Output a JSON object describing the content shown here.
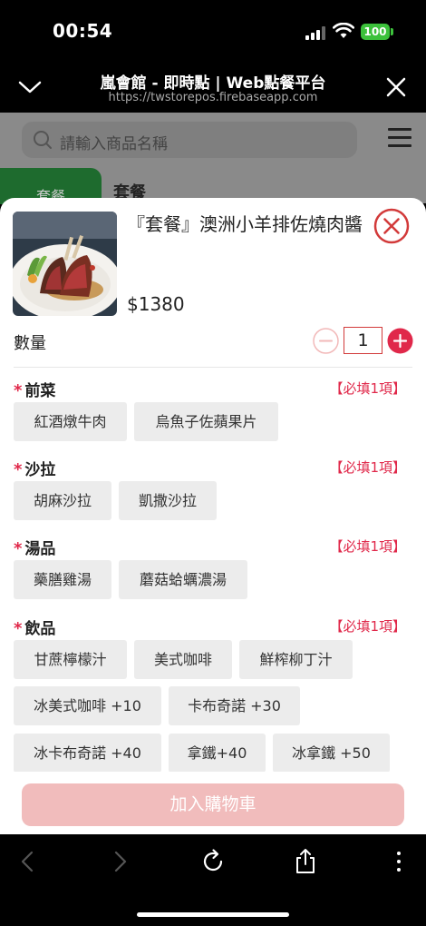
{
  "status_bar": {
    "time": "00:54",
    "battery": "100"
  },
  "browser": {
    "title": "嵐會館 - 即時點 | Web點餐平台",
    "url": "https://twstorepos.firebaseapp.com"
  },
  "page": {
    "search_placeholder": "請輸入商品名稱",
    "category_tab": "套餐",
    "category_heading": "套餐"
  },
  "product": {
    "name": "『套餐』澳洲小羊排佐燒肉醬",
    "price": "$1380"
  },
  "quantity": {
    "label": "數量",
    "value": "1"
  },
  "option_groups": [
    {
      "title": "前菜",
      "required": "【必填1項】",
      "options": [
        "紅酒燉牛肉",
        "烏魚子佐蘋果片"
      ]
    },
    {
      "title": "沙拉",
      "required": "【必填1項】",
      "options": [
        "胡麻沙拉",
        "凱撒沙拉"
      ]
    },
    {
      "title": "湯品",
      "required": "【必填1項】",
      "options": [
        "藥膳雞湯",
        "蘑菇蛤蠣濃湯"
      ]
    },
    {
      "title": "飲品",
      "required": "【必填1項】",
      "options": [
        "甘蔗檸檬汁",
        "美式咖啡",
        "鮮榨柳丁汁",
        "冰美式咖啡 +10",
        "卡布奇諾 +30",
        "冰卡布奇諾 +40",
        "拿鐵+40",
        "冰拿鐵 +50"
      ]
    }
  ],
  "add_to_cart": "加入購物車",
  "colors": {
    "accent": "#e0284a",
    "button_disabled": "#f1bcbc",
    "category_tab": "#1e6b2e"
  }
}
